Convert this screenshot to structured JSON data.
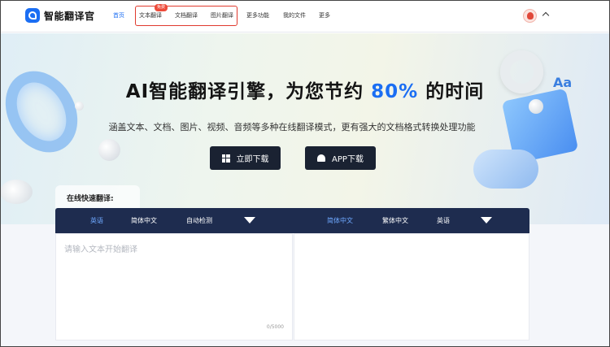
{
  "nav": {
    "logo_text": "智能翻译官",
    "items": [
      {
        "label": "首页",
        "active": true
      },
      {
        "label": "文本翻译"
      },
      {
        "label": "文档翻译"
      },
      {
        "label": "图片翻译"
      },
      {
        "label": "更多功能"
      },
      {
        "label": "我的文件"
      },
      {
        "label": "更多"
      }
    ],
    "badge": "免费"
  },
  "hero": {
    "title_pre": "AI智能翻译引擎，为您节约 ",
    "title_highlight": "80%",
    "title_post": " 的时间",
    "subtitle": "涵盖文本、文档、图片、视频、音频等多种在线翻译模式，更有强大的文档格式转换处理功能",
    "buttons": {
      "windows": "立即下载",
      "app": "APP下载"
    },
    "decor_text": "Aa"
  },
  "translator": {
    "section_label": "在线快速翻译:",
    "source_langs": [
      "英语",
      "简体中文",
      "自动检测"
    ],
    "target_langs": [
      "简体中文",
      "繁体中文",
      "英语"
    ],
    "input_placeholder": "请输入文本开始翻译",
    "char_counter": "0/5000"
  },
  "colors": {
    "accent": "#1b6ef3",
    "lang_bar": "#1e2c4f",
    "button_dark": "#1a2232",
    "highlight_box": "#e03a2e"
  }
}
